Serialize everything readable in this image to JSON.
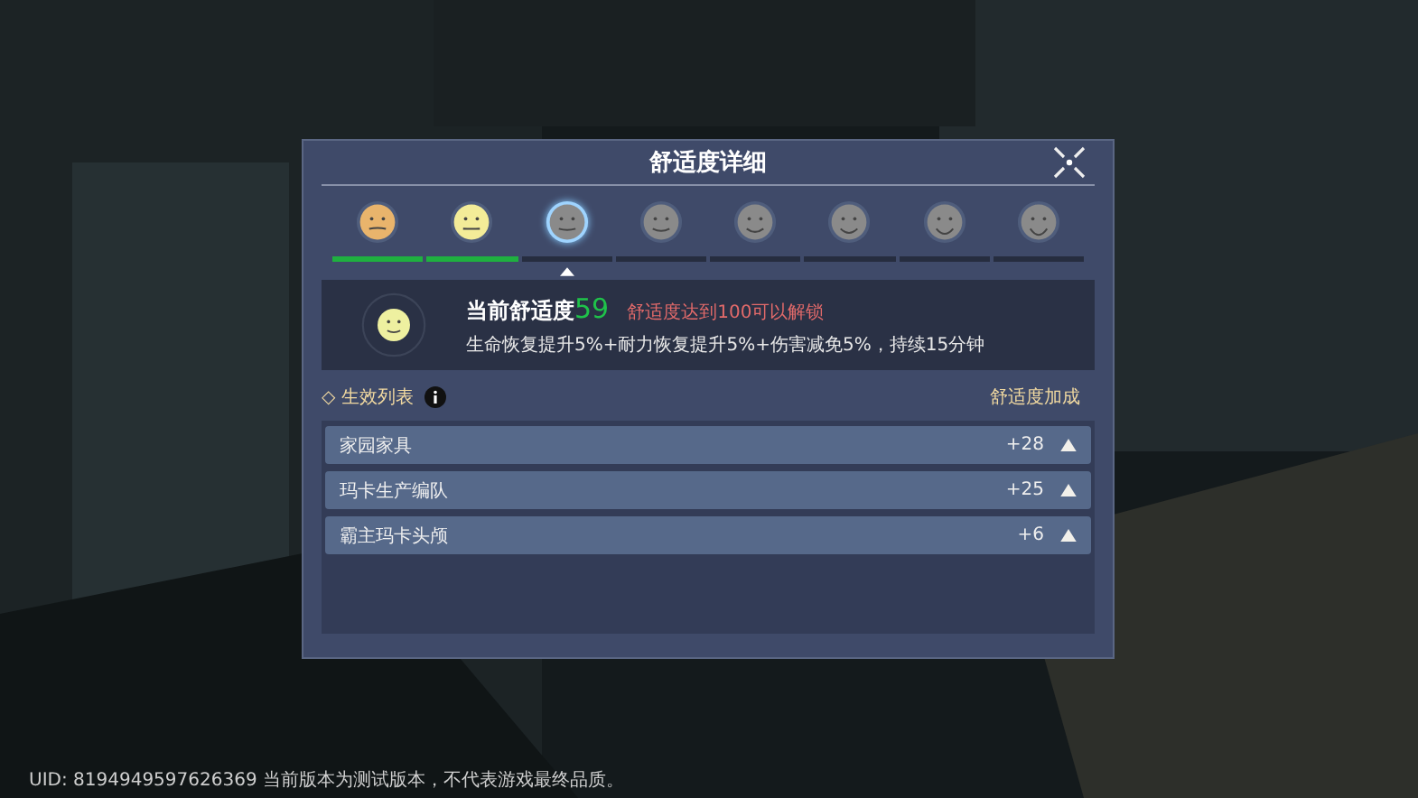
{
  "dialog": {
    "title": "舒适度详细"
  },
  "levels": [
    {
      "color": "#e9b46c",
      "reached": true,
      "selected": false
    },
    {
      "color": "#f3ec98",
      "reached": true,
      "selected": false
    },
    {
      "color": "#8a8a8a",
      "reached": false,
      "selected": true
    },
    {
      "color": "#8a8a8a",
      "reached": false,
      "selected": false
    },
    {
      "color": "#8a8a8a",
      "reached": false,
      "selected": false
    },
    {
      "color": "#8a8a8a",
      "reached": false,
      "selected": false
    },
    {
      "color": "#8a8a8a",
      "reached": false,
      "selected": false
    },
    {
      "color": "#8a8a8a",
      "reached": false,
      "selected": false
    }
  ],
  "current": {
    "label": "当前舒适度",
    "value": "59",
    "unlock_hint": "舒适度达到100可以解锁",
    "effect": "生命恢复提升5%+耐力恢复提升5%+伤害减免5%，持续15分钟"
  },
  "effects": {
    "title": "◇ 生效列表",
    "column": "舒适度加成",
    "rows": [
      {
        "name": "家园家具",
        "bonus": "+28"
      },
      {
        "name": "玛卡生产编队",
        "bonus": "+25"
      },
      {
        "name": "霸主玛卡头颅",
        "bonus": "+6"
      }
    ]
  },
  "footer": "UID: 8194949597626369 当前版本为测试版本，不代表游戏最终品质。"
}
